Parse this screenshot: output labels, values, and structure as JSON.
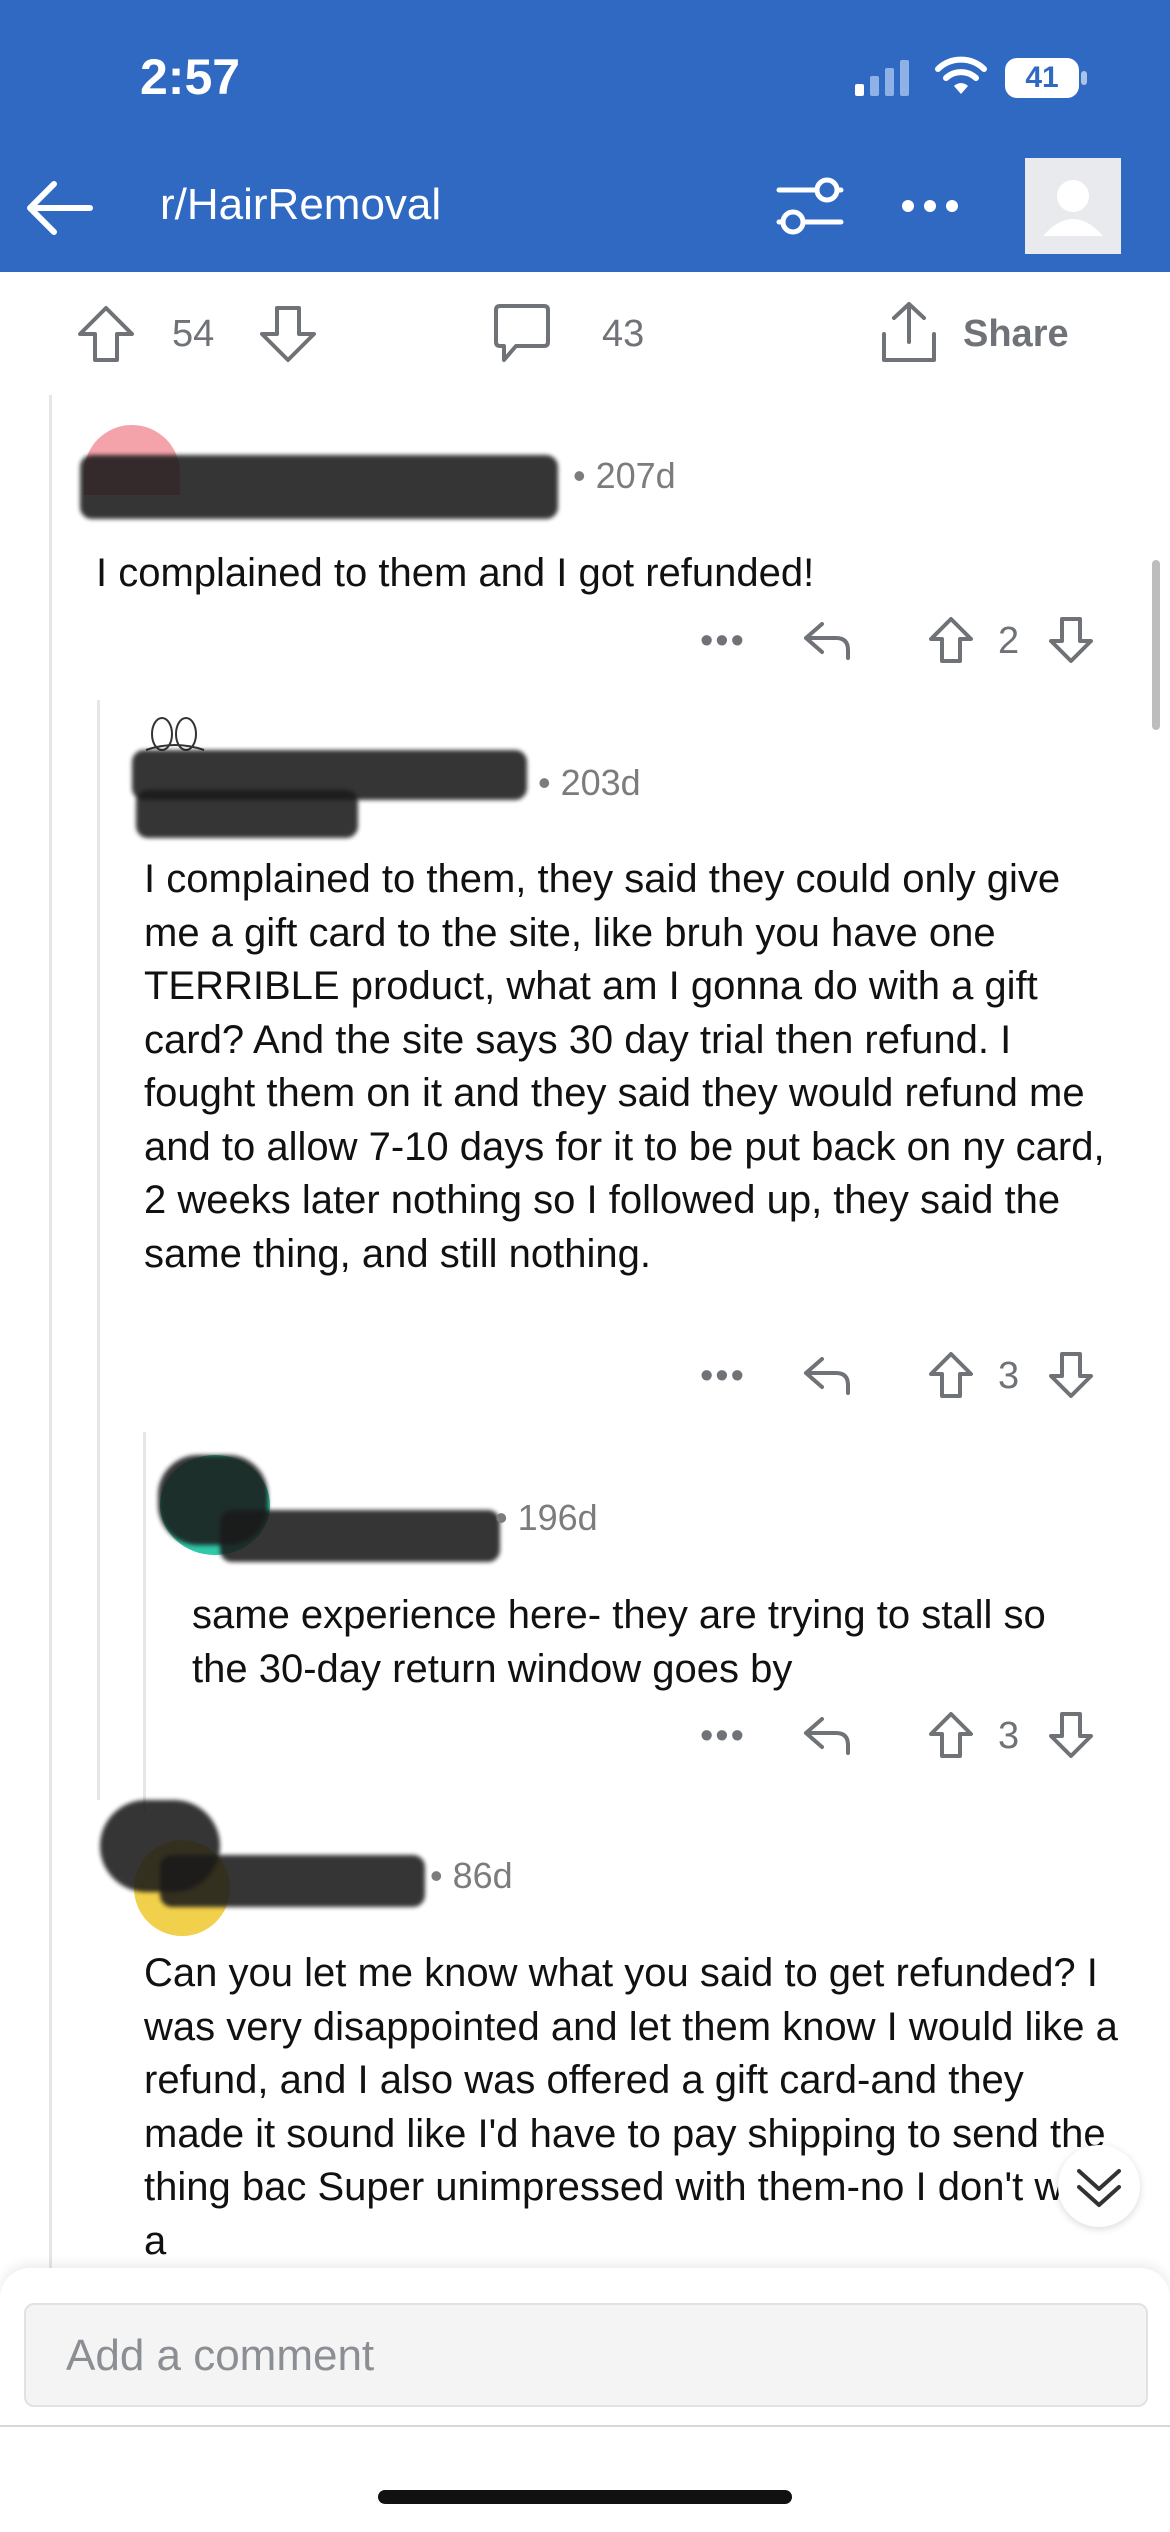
{
  "status_bar": {
    "time": "2:57",
    "battery": "41"
  },
  "nav": {
    "title": "r/HairRemoval"
  },
  "post_actions": {
    "upvotes": "54",
    "comments": "43",
    "share_label": "Share"
  },
  "comments": [
    {
      "age": "• 207d",
      "body": "I complained to them and I got refunded!",
      "score": "2"
    },
    {
      "age": "• 203d",
      "body": "I complained to them, they said they could only give me a gift card to the site, like bruh you have one TERRIBLE product, what am I gonna do with a gift card? And the site says 30 day trial then refund. I fought them on it and they said they would refund me and to allow 7-10 days for it to be put back on ny card, 2 weeks later nothing so I followed up, they said the same thing, and still nothing.",
      "score": "3"
    },
    {
      "age": "• 196d",
      "body": "same experience here- they are trying to stall so the 30-day return window goes by",
      "score": "3"
    },
    {
      "age": "• 86d",
      "body": "Can you let me know what you said to get refunded? I was very disappointed and let them know I would like a refund, and I also was offered a gift card-and they made it sound like I'd have to pay shipping to send the thing bac Super unimpressed with them-no I don't want a"
    }
  ],
  "action_dots": "•••",
  "composer": {
    "placeholder": "Add a comment"
  }
}
